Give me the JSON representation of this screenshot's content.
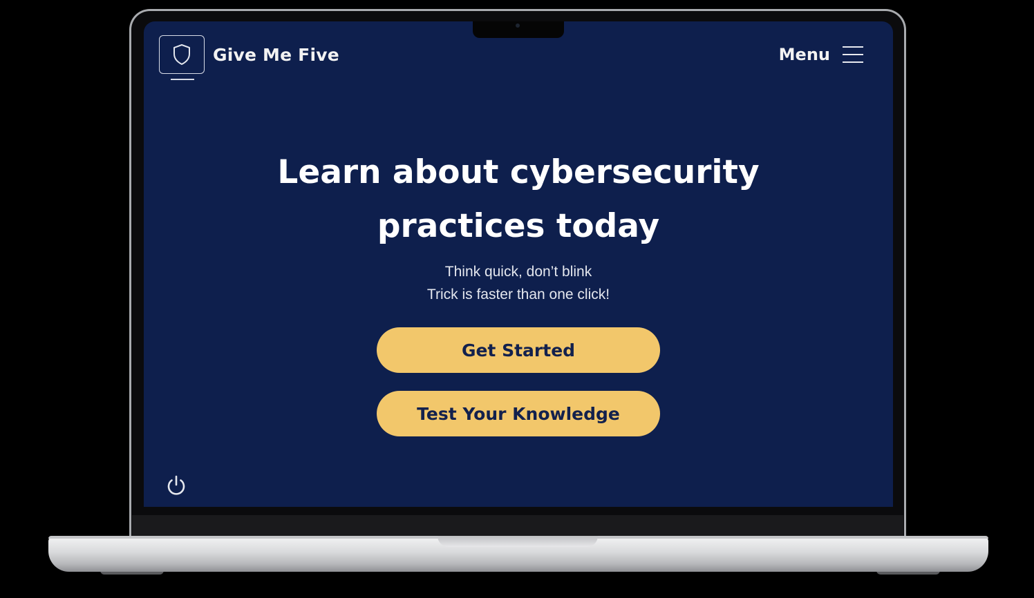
{
  "app": {
    "brand_name": "Give Me Five",
    "menu_label": "Menu"
  },
  "hero": {
    "headline_line1": "Learn about cybersecurity",
    "headline_line2": "practices today",
    "tagline_line1": "Think quick, don’t blink",
    "tagline_line2": "Trick is faster than one click!"
  },
  "actions": {
    "primary_label": "Get Started",
    "secondary_label": "Test Your Knowledge"
  },
  "icons": {
    "logo": "shield-icon",
    "menu": "hamburger-menu-icon",
    "power": "power-icon"
  },
  "colors": {
    "screen_background": "#0e1f4d",
    "button_fill": "#f2c76b",
    "button_text": "#13214d",
    "text_primary": "#ffffff"
  }
}
